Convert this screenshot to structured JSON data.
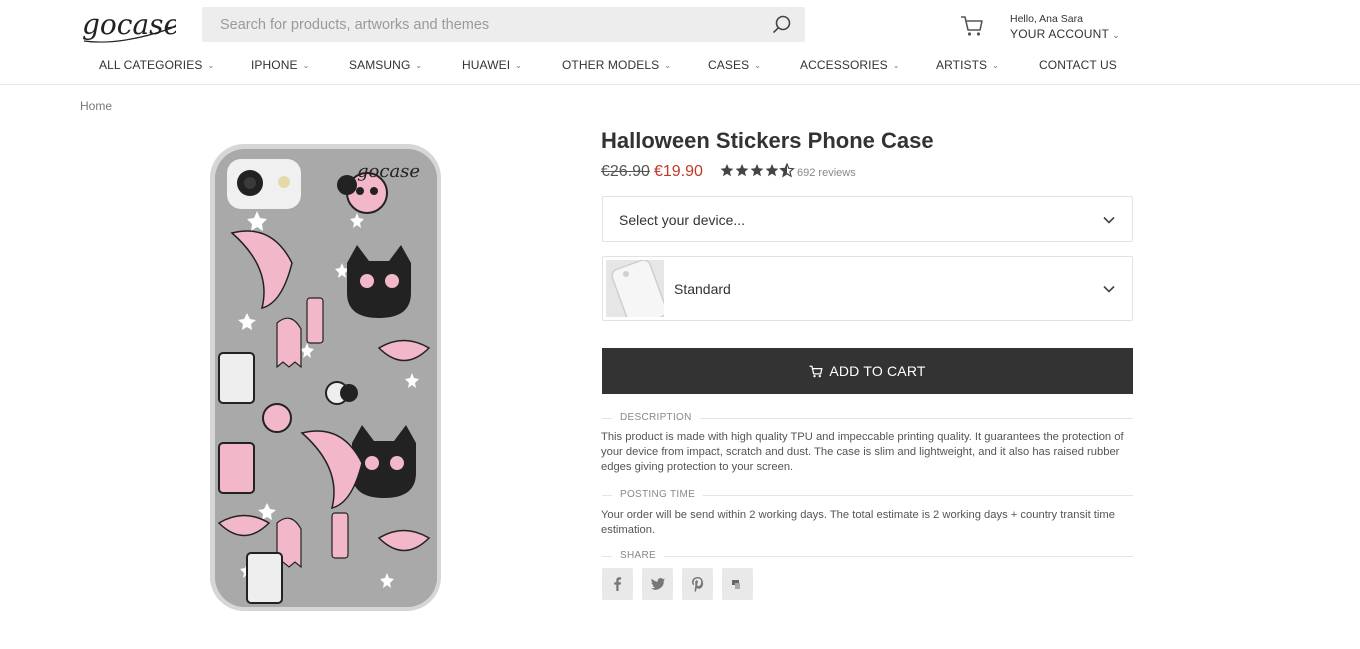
{
  "header": {
    "logo_text": "gocase",
    "search_placeholder": "Search for products, artworks and themes",
    "greeting": "Hello, Ana Sara",
    "account_label": "YOUR ACCOUNT"
  },
  "nav": [
    {
      "label": "ALL CATEGORIES",
      "has_dropdown": true
    },
    {
      "label": "IPHONE",
      "has_dropdown": true
    },
    {
      "label": "SAMSUNG",
      "has_dropdown": true
    },
    {
      "label": "HUAWEI",
      "has_dropdown": true
    },
    {
      "label": "OTHER MODELS",
      "has_dropdown": true
    },
    {
      "label": "CASES",
      "has_dropdown": true
    },
    {
      "label": "ACCESSORIES",
      "has_dropdown": true
    },
    {
      "label": "ARTISTS",
      "has_dropdown": true
    },
    {
      "label": "CONTACT US",
      "has_dropdown": false
    }
  ],
  "breadcrumb": [
    "Home"
  ],
  "product": {
    "title": "Halloween Stickers Phone Case",
    "old_price": "€26.90",
    "price": "€19.90",
    "rating": 4.5,
    "reviews": "692 reviews",
    "device_select_placeholder": "Select your device...",
    "case_type_value": "Standard",
    "add_to_cart_label": "ADD TO CART"
  },
  "sections": {
    "description_title": "DESCRIPTION",
    "description_text": "This product is made with high quality TPU and impeccable printing quality. It guarantees the protection of your device from impact, scratch and dust. The case is slim and lightweight, and it also has raised rubber edges giving protection to your screen.",
    "posting_title": "POSTING TIME",
    "posting_text": "Your order will be send within 2 working days. The total estimate is 2 working days + country transit time estimation.",
    "share_title": "SHARE"
  },
  "share_icons": [
    "facebook-icon",
    "twitter-icon",
    "pinterest-icon",
    "tumblr-icon"
  ],
  "colors": {
    "accent_price": "#c0392b",
    "button_bg": "#333333",
    "case_pink": "#f2b8c9"
  }
}
